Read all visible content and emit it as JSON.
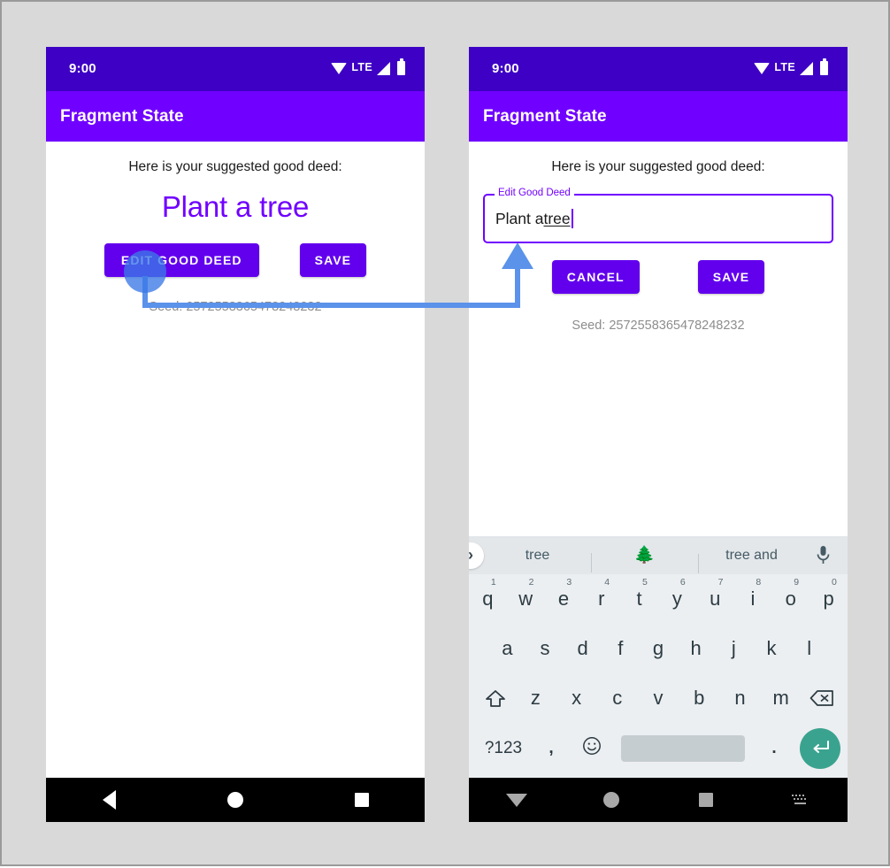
{
  "background": {
    "page": "#d9d9d9",
    "border": "#9a9a9a"
  },
  "colors": {
    "status_bar": "#3d00c4",
    "app_bar": "#7000ff",
    "primary_purple": "#6200ee",
    "headline_purple": "#7000ff",
    "annotation_blue": "#5b92ea",
    "enter_key_teal": "#3aa38f"
  },
  "left_phone": {
    "status_bar": {
      "time": "9:00",
      "network_label": "LTE",
      "icons": [
        "wifi-icon",
        "signal-icon",
        "battery-icon"
      ]
    },
    "app_bar": {
      "title": "Fragment State"
    },
    "content": {
      "subtitle": "Here is your suggested good deed:",
      "headline": "Plant a tree",
      "buttons": [
        {
          "label": "EDIT GOOD DEED",
          "name": "edit-good-deed-button"
        },
        {
          "label": "SAVE",
          "name": "save-button"
        }
      ],
      "seed": "Seed: 2572558365478248232"
    },
    "nav_bar": {
      "items": [
        "back-icon",
        "home-icon",
        "recents-icon"
      ]
    }
  },
  "right_phone": {
    "status_bar": {
      "time": "9:00",
      "network_label": "LTE",
      "icons": [
        "wifi-icon",
        "signal-icon",
        "battery-icon"
      ]
    },
    "app_bar": {
      "title": "Fragment State"
    },
    "content": {
      "subtitle": "Here is your suggested good deed:",
      "text_field": {
        "label": "Edit Good Deed",
        "value_prefix": "Plant a ",
        "value_composing": "tree",
        "value_full": "Plant a tree"
      },
      "buttons": [
        {
          "label": "CANCEL",
          "name": "cancel-button"
        },
        {
          "label": "SAVE",
          "name": "save-button"
        }
      ],
      "seed": "Seed: 2572558365478248232"
    },
    "keyboard": {
      "suggestions": {
        "expand_icon": "chevron-right-icon",
        "items": [
          "tree",
          "🌲",
          "tree and"
        ],
        "mic_icon": "microphone-icon"
      },
      "row1": [
        {
          "key": "q",
          "num": "1"
        },
        {
          "key": "w",
          "num": "2"
        },
        {
          "key": "e",
          "num": "3"
        },
        {
          "key": "r",
          "num": "4"
        },
        {
          "key": "t",
          "num": "5"
        },
        {
          "key": "y",
          "num": "6"
        },
        {
          "key": "u",
          "num": "7"
        },
        {
          "key": "i",
          "num": "8"
        },
        {
          "key": "o",
          "num": "9"
        },
        {
          "key": "p",
          "num": "0"
        }
      ],
      "row2": [
        "a",
        "s",
        "d",
        "f",
        "g",
        "h",
        "j",
        "k",
        "l"
      ],
      "row3_letters": [
        "z",
        "x",
        "c",
        "v",
        "b",
        "n",
        "m"
      ],
      "row3_shift_icon": "shift-icon",
      "row3_delete_icon": "backspace-icon",
      "row4": {
        "symbols_label": "?123",
        "comma": ",",
        "emoji_icon": "emoji-icon",
        "space_label": "",
        "period": ".",
        "enter_icon": "enter-icon"
      }
    },
    "nav_bar": {
      "items": [
        "hide-keyboard-icon",
        "home-icon",
        "recents-icon",
        "keyboard-switch-icon"
      ]
    }
  },
  "annotation": {
    "click_target": "edit-good-deed-button",
    "arrow_to": "edit-good-deed-text-field"
  }
}
